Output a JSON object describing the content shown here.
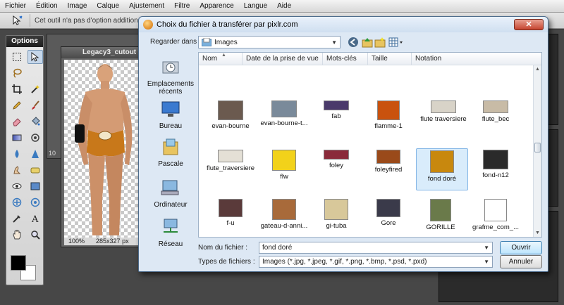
{
  "menu": [
    "Fichier",
    "Édition",
    "Image",
    "Calque",
    "Ajustement",
    "Filtre",
    "Apparence",
    "Langue",
    "Aide"
  ],
  "optbar": {
    "hint": "Cet outil n'a pas d'option additionn"
  },
  "tools": {
    "title": "Options"
  },
  "document": {
    "title": "Legacy3_cutout",
    "zoom": "100%",
    "size": "285x327 px",
    "back_zoom": "10"
  },
  "dialog": {
    "title": "Choix du fichier à transférer par pixlr.com",
    "close": "✕",
    "look_in_label": "Regarder dans :",
    "look_in_value": "Images",
    "places": [
      "Emplacements récents",
      "Bureau",
      "Pascale",
      "Ordinateur",
      "Réseau"
    ],
    "columns": [
      "Nom",
      "Date de la prise de vue",
      "Mots-clés",
      "Taille",
      "Notation"
    ],
    "files": [
      {
        "name": "evan-bourne",
        "color": "#6b5a4f"
      },
      {
        "name": "evan-bourne-t...",
        "color": "#7a8a9a"
      },
      {
        "name": "fab",
        "color": "#4a3a6a"
      },
      {
        "name": "flamme-1",
        "color": "#c9520e"
      },
      {
        "name": "flute traversiere",
        "color": "#d8d3c8"
      },
      {
        "name": "flute_bec",
        "color": "#c8bba6"
      },
      {
        "name": "flute_traversiere",
        "color": "#e4e0d6"
      },
      {
        "name": "flw",
        "color": "#f2d21a"
      },
      {
        "name": "foley",
        "color": "#8a2a3a"
      },
      {
        "name": "foleyfired",
        "color": "#9a4a1a"
      },
      {
        "name": "fond doré",
        "color": "#c8880e"
      },
      {
        "name": "fond-n12",
        "color": "#2a2a2a"
      },
      {
        "name": "f-u",
        "color": "#5a3a3a"
      },
      {
        "name": "gateau-d-anni...",
        "color": "#a86a3a"
      },
      {
        "name": "gi-tuba",
        "color": "#d8c89a"
      },
      {
        "name": "Gore",
        "color": "#3a3a4a"
      },
      {
        "name": "GORILLE",
        "color": "#6a7a4a"
      },
      {
        "name": "grafme_com_..."
      }
    ],
    "filename_label": "Nom du fichier :",
    "filename_value": "fond doré",
    "filetype_label": "Types de fichiers :",
    "filetype_value": "Images (*.jpg, *.jpeg, *.gif, *.png, *.bmp, *.psd, *.pxd)",
    "open_button": "Ouvrir",
    "cancel_button": "Annuler"
  }
}
